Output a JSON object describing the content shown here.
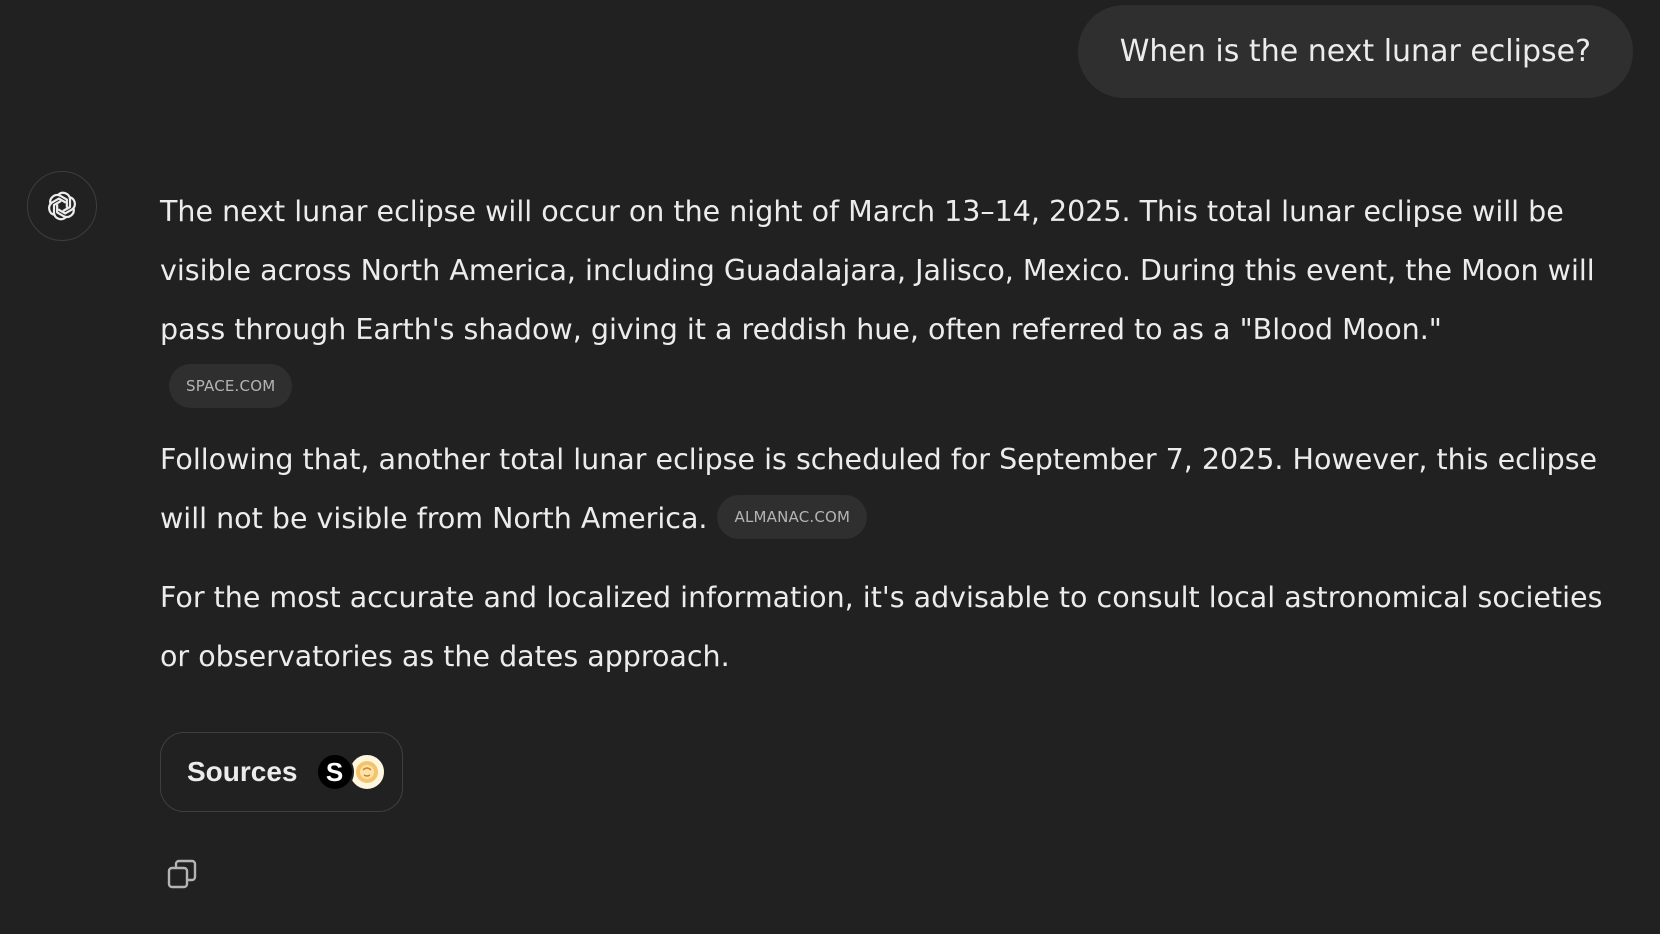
{
  "conversation": {
    "user_message": "When is the next lunar eclipse?",
    "assistant": {
      "paragraphs": [
        {
          "text": "The next lunar eclipse will occur on the night of March 13–14, 2025. This total lunar eclipse will be visible across North America, including Guadalajara, Jalisco, Mexico. During this event, the Moon will pass through Earth's shadow, giving it a reddish hue, often referred to as a \"Blood Moon.\"",
          "citation": "SPACE.COM"
        },
        {
          "text": "Following that, another total lunar eclipse is scheduled for September 7, 2025. However, this eclipse will not be visible from North America.",
          "citation": "ALMANAC.COM"
        },
        {
          "text": "For the most accurate and localized information, it's advisable to consult local astronomical societies or observatories as the dates approach."
        }
      ],
      "sources": {
        "label": "Sources",
        "favicons": [
          {
            "name": "space-favicon",
            "glyph": "S"
          },
          {
            "name": "almanac-favicon",
            "glyph": ""
          }
        ]
      }
    }
  },
  "icons": {
    "assistant_avatar": "openai-logo-icon",
    "copy": "copy-icon"
  },
  "colors": {
    "background": "#212121",
    "bubble": "#2f2f2f",
    "text": "#ececec",
    "muted_text": "#b4b4b4"
  }
}
